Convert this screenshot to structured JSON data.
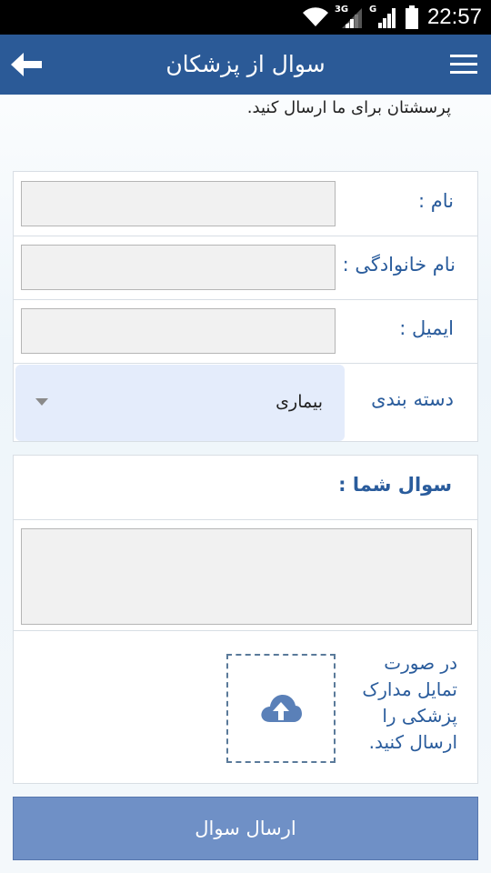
{
  "status_bar": {
    "network_3g": "3G",
    "network_g": "G",
    "time": "22:57",
    "icons": [
      "wifi-icon",
      "signal-icon",
      "signal-icon",
      "battery-icon"
    ]
  },
  "app_bar": {
    "title": "سوال از پزشکان",
    "back_icon": "arrow-left-icon",
    "menu_icon": "hamburger-menu-icon",
    "color": "#2b5a97"
  },
  "intro_text": "پرسشتان برای ما ارسال کنید.",
  "form": {
    "first_name_label": "نام :",
    "first_name_value": "",
    "last_name_label": "نام خانوادگی :",
    "last_name_value": "",
    "email_label": "ایمیل :",
    "email_value": "",
    "category_label": "دسته بندی",
    "category_selected": "بیماری"
  },
  "question": {
    "label": "سوال شما :",
    "value": "",
    "upload_text": "در صورت تمایل مدارک پزشکی را ارسال کنید.",
    "upload_icon": "cloud-upload-icon"
  },
  "submit": {
    "label": "ارسال سوال",
    "color": "#6f90c6"
  },
  "accent_color": "#2a5c9c"
}
